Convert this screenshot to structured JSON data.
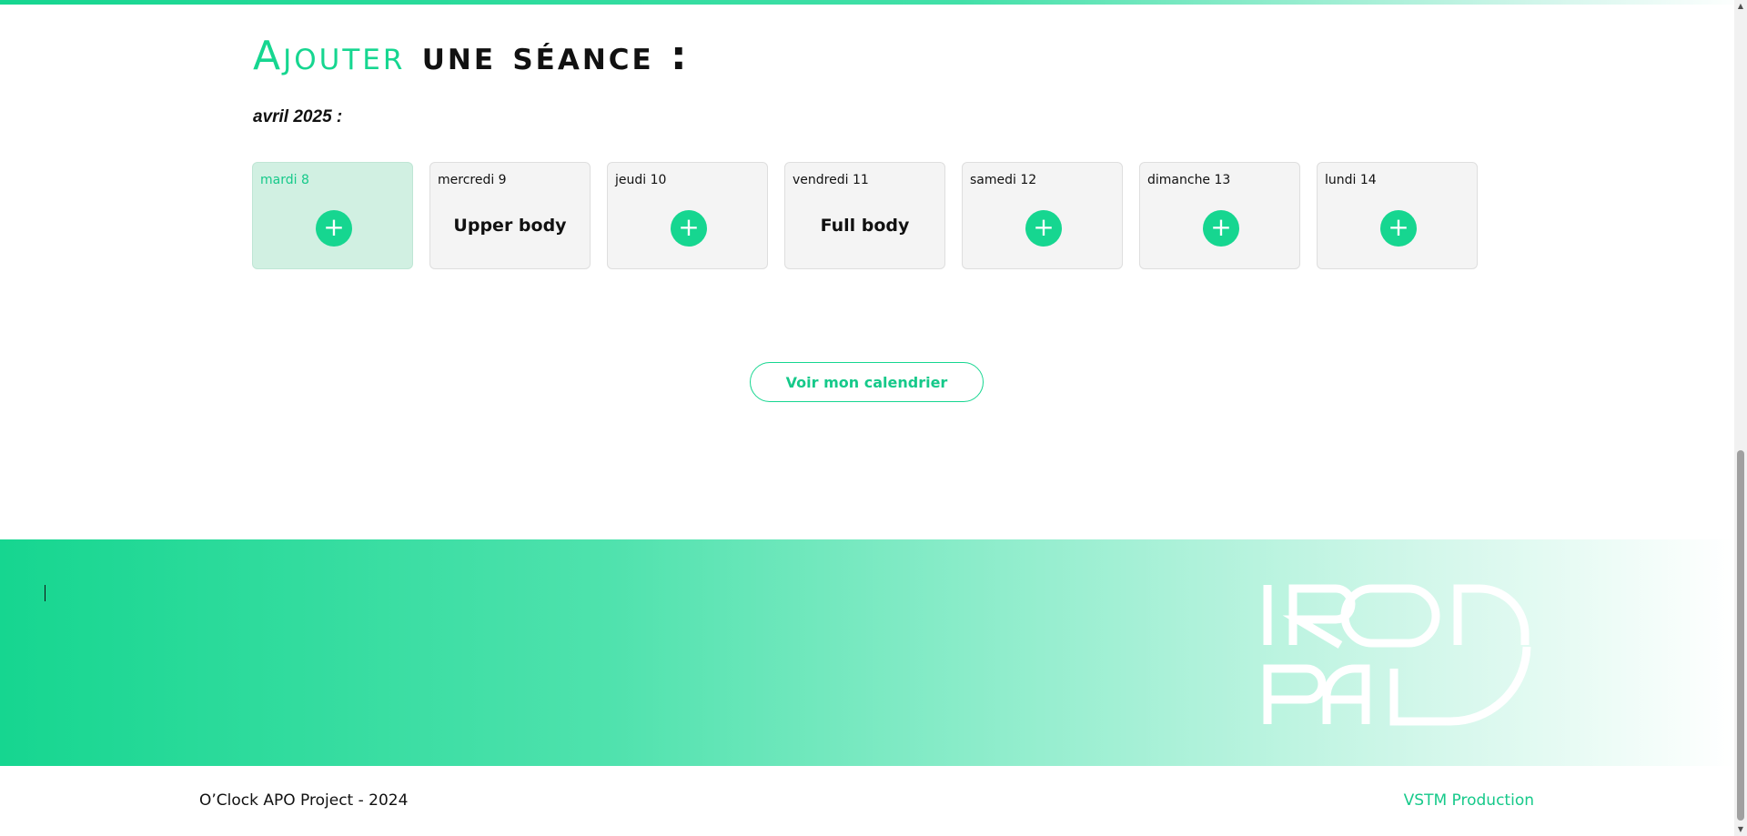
{
  "page": {
    "title_accent": "Ajouter",
    "title_rest": " une séance :",
    "month": "avril 2025 :"
  },
  "days": [
    {
      "label": "mardi 8",
      "session": null,
      "active": true
    },
    {
      "label": "mercredi 9",
      "session": "Upper body",
      "active": false
    },
    {
      "label": "jeudi 10",
      "session": null,
      "active": false
    },
    {
      "label": "vendredi 11",
      "session": "Full body",
      "active": false
    },
    {
      "label": "samedi 12",
      "session": null,
      "active": false
    },
    {
      "label": "dimanche 13",
      "session": null,
      "active": false
    },
    {
      "label": "lundi 14",
      "session": null,
      "active": false
    }
  ],
  "add_icon": "plus-icon",
  "calendar_button": {
    "label": "Voir mon calendrier"
  },
  "footer": {
    "logo_text_line1": "IRON",
    "logo_text_line2": "PAL",
    "copyright": "O’Clock APO Project - 2024",
    "credits": "VSTM Production"
  },
  "colors": {
    "accent": "#16d690",
    "active_card": "#d1f0e2",
    "card": "#f4f4f4"
  }
}
